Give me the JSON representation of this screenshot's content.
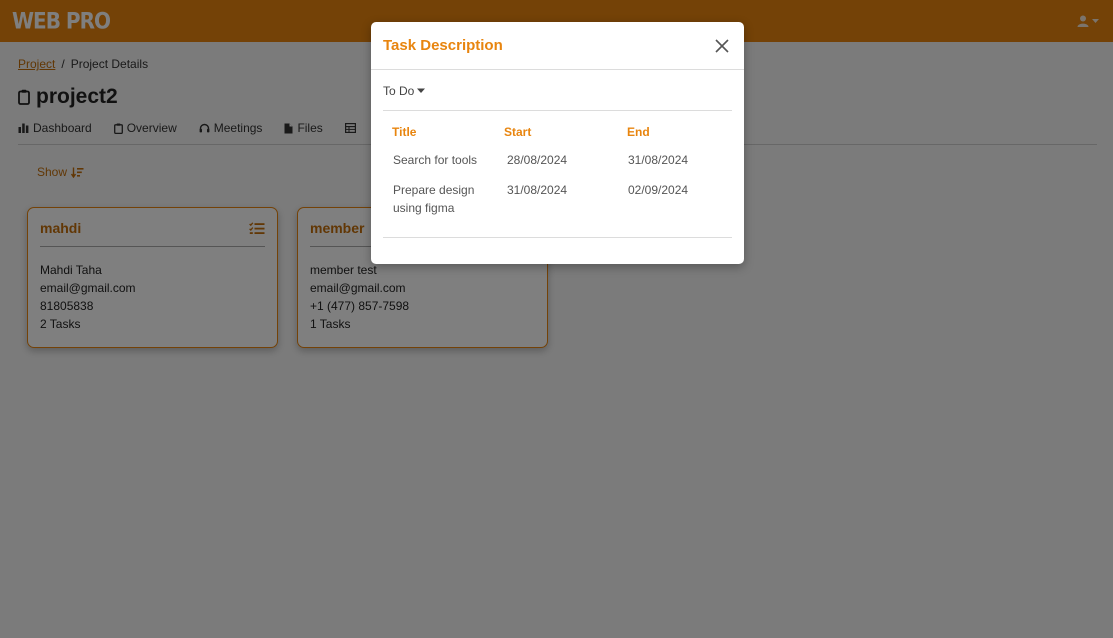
{
  "colors": {
    "accent": "#e8850f",
    "accent_dark": "#c46f0a"
  },
  "topbar": {
    "logo": "WEB PRO",
    "user_icon": "user-icon",
    "caret_icon": "caret-down-icon"
  },
  "breadcrumb": {
    "root": "Project",
    "separator": "/",
    "current": "Project Details"
  },
  "page": {
    "title": "project2",
    "title_icon": "clipboard-icon"
  },
  "tabs": [
    {
      "label": "Dashboard",
      "icon": "bar-chart-icon"
    },
    {
      "label": "Overview",
      "icon": "clipboard-icon"
    },
    {
      "label": "Meetings",
      "icon": "headset-icon"
    },
    {
      "label": "Files",
      "icon": "file-icon"
    },
    {
      "label": "",
      "icon": "table-icon"
    }
  ],
  "show_button": {
    "label": "Show",
    "icon": "sort-icon"
  },
  "members": [
    {
      "name": "mahdi",
      "full_name": "Mahdi Taha",
      "email": "email@gmail.com",
      "phone": "81805838",
      "tasks": "2 Tasks",
      "icon": "task-list-icon"
    },
    {
      "name": "member",
      "full_name": "member test",
      "email": "email@gmail.com",
      "phone": "+1 (477) 857-7598",
      "tasks": "1 Tasks"
    }
  ],
  "modal": {
    "title": "Task Description",
    "close_icon": "close-icon",
    "status": "To Do",
    "columns": {
      "title": "Title",
      "start": "Start",
      "end": "End"
    },
    "tasks": [
      {
        "title": "Search for tools",
        "start": "28/08/2024",
        "end": "31/08/2024"
      },
      {
        "title": "Prepare design using figma",
        "start": "31/08/2024",
        "end": "02/09/2024"
      }
    ]
  }
}
